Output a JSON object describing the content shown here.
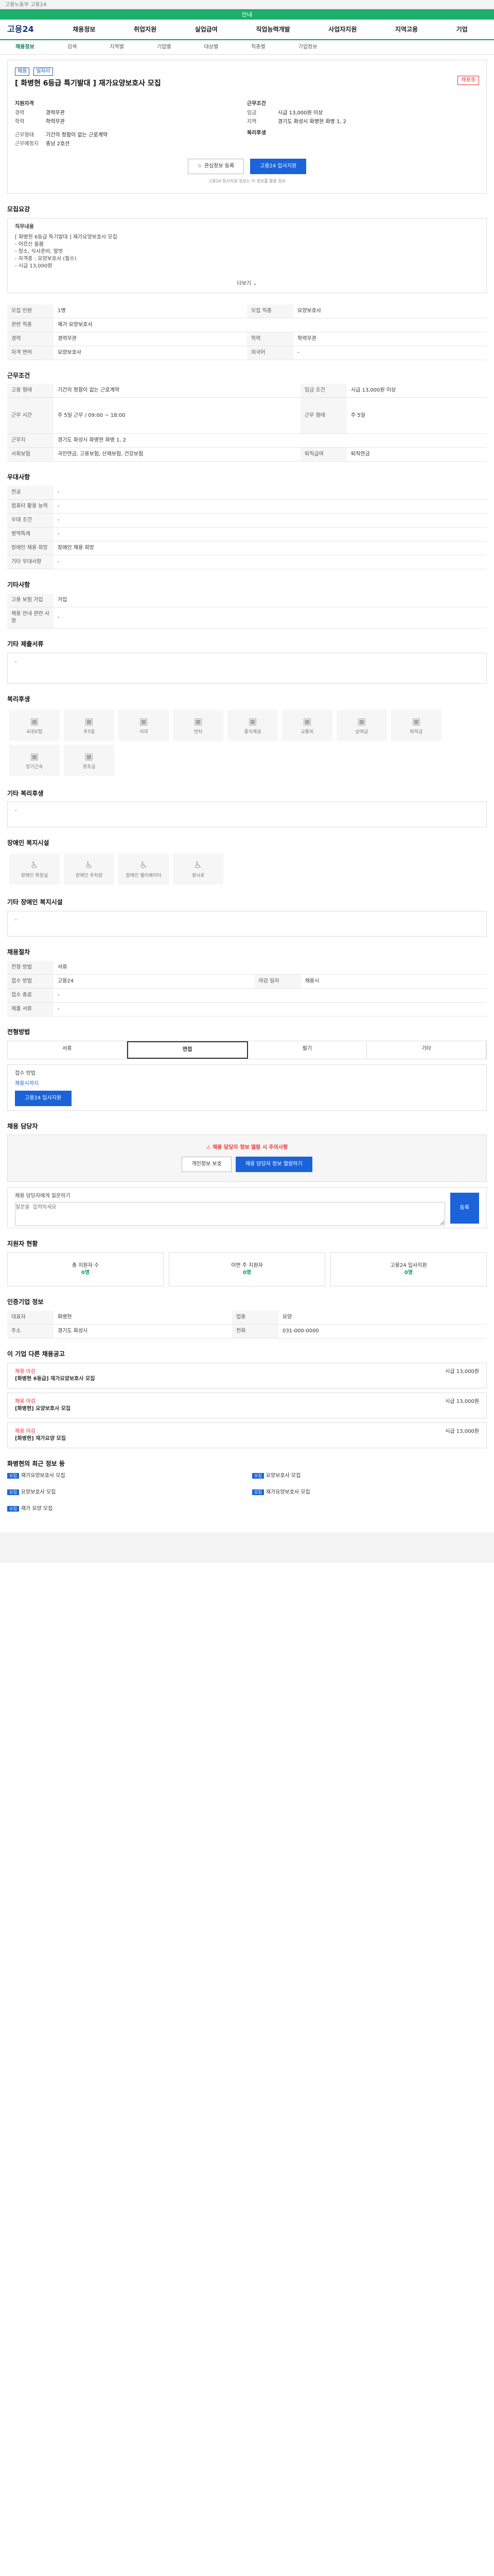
{
  "topbar": "고용노동부 고용24",
  "notice": "안내",
  "header": {
    "logo": "고용24",
    "menu": [
      "채용정보",
      "취업지원",
      "실업급여",
      "직업능력개발",
      "사업자지원",
      "지역고용",
      "기업"
    ]
  },
  "lnb": [
    "채용정보",
    "검색",
    "지역별",
    "기업별",
    "대상별",
    "직종별",
    "기업정보"
  ],
  "job": {
    "tags": [
      "채용",
      "일자리"
    ],
    "dday": "채용중",
    "title": "[ 화병현 6등급 특기발대 ] 재가요양보호사 모집",
    "left_title": "지원자격",
    "left": [
      [
        "경력",
        "경력무관"
      ],
      [
        "학력",
        "학력무관"
      ]
    ],
    "left2": [
      [
        "근무형태",
        "기간의 정함이 없는 근로계약"
      ],
      [
        "근무예정지",
        "충남 2호선"
      ]
    ],
    "right_title": "근무조건",
    "right": [
      [
        "임금",
        "시급 13,000원 이상"
      ],
      [
        "지역",
        "경기도 화성시 화병현 화병 1, 2"
      ]
    ],
    "right2_title": "복리후생",
    "apply": "접수 마감",
    "btn1": "관심정보 등록",
    "btn2": "고용24 입사지원",
    "note": "고용24 입사지원 정보는 이 정보를 활용 정보"
  },
  "guide": {
    "title": "모집요강",
    "subtitle": "직무내용",
    "lines": [
      "[ 화병현 6등급 특기발대 ] 재가요양보호사 모집",
      "- 어르신 돌봄",
      "- 청소, 식사준비, 말벗",
      "- 자격증 : 요양보호사 (필수)",
      "- 시급 13,000원"
    ],
    "more": "더보기"
  },
  "spec": [
    [
      "모집 인원",
      "1명"
    ],
    [
      "모집 직종",
      "요양보호사"
    ],
    [
      "관련 직종",
      "재가 요양보호사"
    ],
    [
      "경력",
      "경력무관"
    ],
    [
      "학력",
      "학력무관"
    ],
    [
      "자격 면허",
      "요양보호사"
    ],
    [
      "외국어",
      "-"
    ]
  ],
  "work": {
    "title": "근무조건",
    "rows": [
      [
        "고용 형태",
        "기간의 정함이 없는 근로계약",
        "임금 조건",
        "시급 13,000원 이상"
      ],
      [
        "근무 시간",
        "주 5일 근무 / 09:00 ~ 18:00",
        "근무 형태",
        "주 5일"
      ],
      [
        "근무지",
        "경기도 화성시 화병현 화병 1, 2",
        "",
        ""
      ],
      [
        "사회보험",
        "국민연금, 고용보험, 산재보험, 건강보험",
        "퇴직급여",
        "퇴직연금"
      ]
    ]
  },
  "env": {
    "title": "우대사항",
    "rows": [
      [
        "전공",
        "-"
      ],
      [
        "컴퓨터 활용 능력",
        "-"
      ],
      [
        "우대 조건",
        "-"
      ],
      [
        "병역특례",
        "-"
      ],
      [
        "장애인 채용 희망",
        "장애인 채용 희망"
      ],
      [
        "기타 우대사항",
        "-"
      ]
    ]
  },
  "etc": {
    "title": "기타사항",
    "rows": [
      [
        "고용 보험 가입",
        "가입"
      ],
      [
        "채용 안내 관련 사항",
        "-"
      ]
    ]
  },
  "doc": {
    "title": "기타 제출서류",
    "value": "-"
  },
  "welfare": {
    "title": "복리후생",
    "items": [
      "4대보험",
      "주5일",
      "식대",
      "연차",
      "중식제공",
      "교통비",
      "상여금",
      "퇴직금",
      "장기근속",
      "경조금"
    ]
  },
  "etc2": {
    "title": "기타 복리후생",
    "value": "-"
  },
  "disab": {
    "title": "장애인 복지시설",
    "items": [
      "장애인 화장실",
      "장애인 주차장",
      "장애인 엘리베이터",
      "경사로"
    ]
  },
  "disab_etc": {
    "title": "기타 장애인 복지시설",
    "value": "-"
  },
  "apply": {
    "title": "채용절차",
    "rows": [
      [
        "전형 방법",
        "서류"
      ],
      [
        "접수 방법",
        "고용24",
        "마감 일자",
        "채용시"
      ],
      [
        "접수 종료",
        "-"
      ],
      [
        "제출 서류",
        "-"
      ]
    ]
  },
  "contact": {
    "title": "전형방법",
    "tabs": [
      "서류",
      "면접",
      "필기",
      "기타"
    ],
    "label": "접수 방법",
    "value": "채용시까지",
    "btn": "고용24 입사지원"
  },
  "report": {
    "title": "채용 담당자",
    "warn": "채용 담당자 정보 열람 시 주의사항",
    "btn1": "개인정보 보호",
    "btn2": "채용 담당자 정보 열람하기",
    "input_label": "채용 담당자에게 질문하기",
    "input_ph": "질문을 입력하세요",
    "submit": "등록"
  },
  "stats": {
    "title": "지원자 현황",
    "items": [
      [
        "총 지원자 수",
        "0명"
      ],
      [
        "이번 주 지원자",
        "0명"
      ],
      [
        "고용24 입사지원",
        "0명"
      ]
    ]
  },
  "company": {
    "title": "인증기업 정보",
    "rows": [
      [
        "대표자",
        "화병현",
        "업종",
        "요양"
      ],
      [
        "주소",
        "경기도 화성시",
        "전화",
        "031-000-0000"
      ]
    ]
  },
  "recom": {
    "title": "이 기업 다른 채용공고",
    "items": [
      [
        "채용 마감",
        "[화병현 6등급] 재가요양보호사 모집",
        "시급 13,000원"
      ],
      [
        "채용 마감",
        "[화병현] 요양보호사 모집",
        "시급 13,000원"
      ],
      [
        "채용 마감",
        "[화병현] 재가요양 모집",
        "시급 13,000원"
      ]
    ]
  },
  "news": {
    "title": "화병현의 최근 정보 등",
    "left": [
      [
        "모집",
        "재가요양보호사 모집"
      ],
      [
        "모집",
        "요양보호사 모집"
      ],
      [
        "모집",
        "재가 요양 모집"
      ]
    ],
    "right": [
      [
        "모집",
        "요양보호사 모집"
      ],
      [
        "모집",
        "재가요양보호사 모집"
      ]
    ]
  }
}
